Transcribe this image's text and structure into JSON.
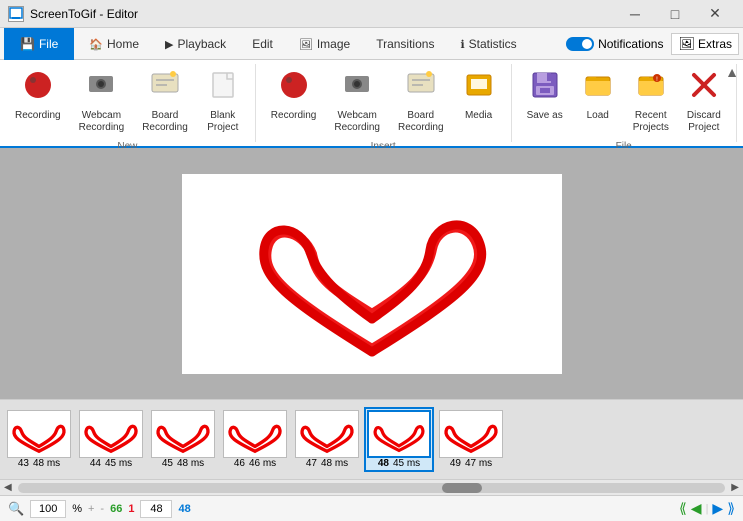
{
  "titlebar": {
    "app_name": "ScreenToGif - Editor",
    "icon": "🎬",
    "btns": [
      "─",
      "□",
      "✕"
    ]
  },
  "tabs": [
    {
      "id": "file",
      "label": "File",
      "icon": "💾",
      "active": true,
      "file_tab": true
    },
    {
      "id": "home",
      "label": "Home",
      "icon": "🏠",
      "active": false
    },
    {
      "id": "playback",
      "label": "Playback",
      "icon": "▶",
      "active": false
    },
    {
      "id": "edit",
      "label": "Edit",
      "icon": "",
      "active": false
    },
    {
      "id": "image",
      "label": "Image",
      "icon": "🖼",
      "active": false
    },
    {
      "id": "transitions",
      "label": "Transitions",
      "icon": "⧉",
      "active": false
    },
    {
      "id": "statistics",
      "label": "Statistics",
      "icon": "ℹ",
      "active": false
    }
  ],
  "topright": {
    "notifications_label": "Notifications",
    "extras_label": "Extras"
  },
  "ribbon": {
    "groups": [
      {
        "id": "new",
        "label": "New",
        "items": [
          {
            "id": "recording",
            "label": "Recording",
            "icon": "bomb"
          },
          {
            "id": "webcam-recording",
            "label": "Webcam\nRecording",
            "icon": "camera"
          },
          {
            "id": "board-recording",
            "label": "Board\nRecording",
            "icon": "board"
          },
          {
            "id": "blank-project",
            "label": "Blank\nProject",
            "icon": "blank"
          }
        ]
      },
      {
        "id": "insert",
        "label": "Insert",
        "items": [
          {
            "id": "recording2",
            "label": "Recording",
            "icon": "bomb"
          },
          {
            "id": "webcam-recording2",
            "label": "Webcam\nRecording",
            "icon": "camera"
          },
          {
            "id": "board-recording2",
            "label": "Board\nRecording",
            "icon": "board"
          },
          {
            "id": "media",
            "label": "Media",
            "icon": "media"
          }
        ]
      },
      {
        "id": "file-group",
        "label": "File",
        "items": [
          {
            "id": "save-as",
            "label": "Save as",
            "icon": "saveas"
          },
          {
            "id": "load",
            "label": "Load",
            "icon": "load"
          },
          {
            "id": "recent-projects",
            "label": "Recent\nProjects",
            "icon": "recent"
          },
          {
            "id": "discard-project",
            "label": "Discard\nProject",
            "icon": "discard"
          }
        ]
      }
    ]
  },
  "filmstrip": {
    "frames": [
      {
        "num": "43",
        "ms": "48 ms",
        "selected": false
      },
      {
        "num": "44",
        "ms": "45 ms",
        "selected": false
      },
      {
        "num": "45",
        "ms": "48 ms",
        "selected": false
      },
      {
        "num": "46",
        "ms": "46 ms",
        "selected": false
      },
      {
        "num": "47",
        "ms": "48 ms",
        "selected": false
      },
      {
        "num": "48",
        "ms": "45 ms",
        "selected": true
      },
      {
        "num": "49",
        "ms": "47 ms",
        "selected": false
      }
    ]
  },
  "statusbar": {
    "zoom_value": "100",
    "zoom_percent": "%",
    "count_green": "66",
    "count_red": "1",
    "count_blue": "48",
    "frame_input": "48"
  }
}
